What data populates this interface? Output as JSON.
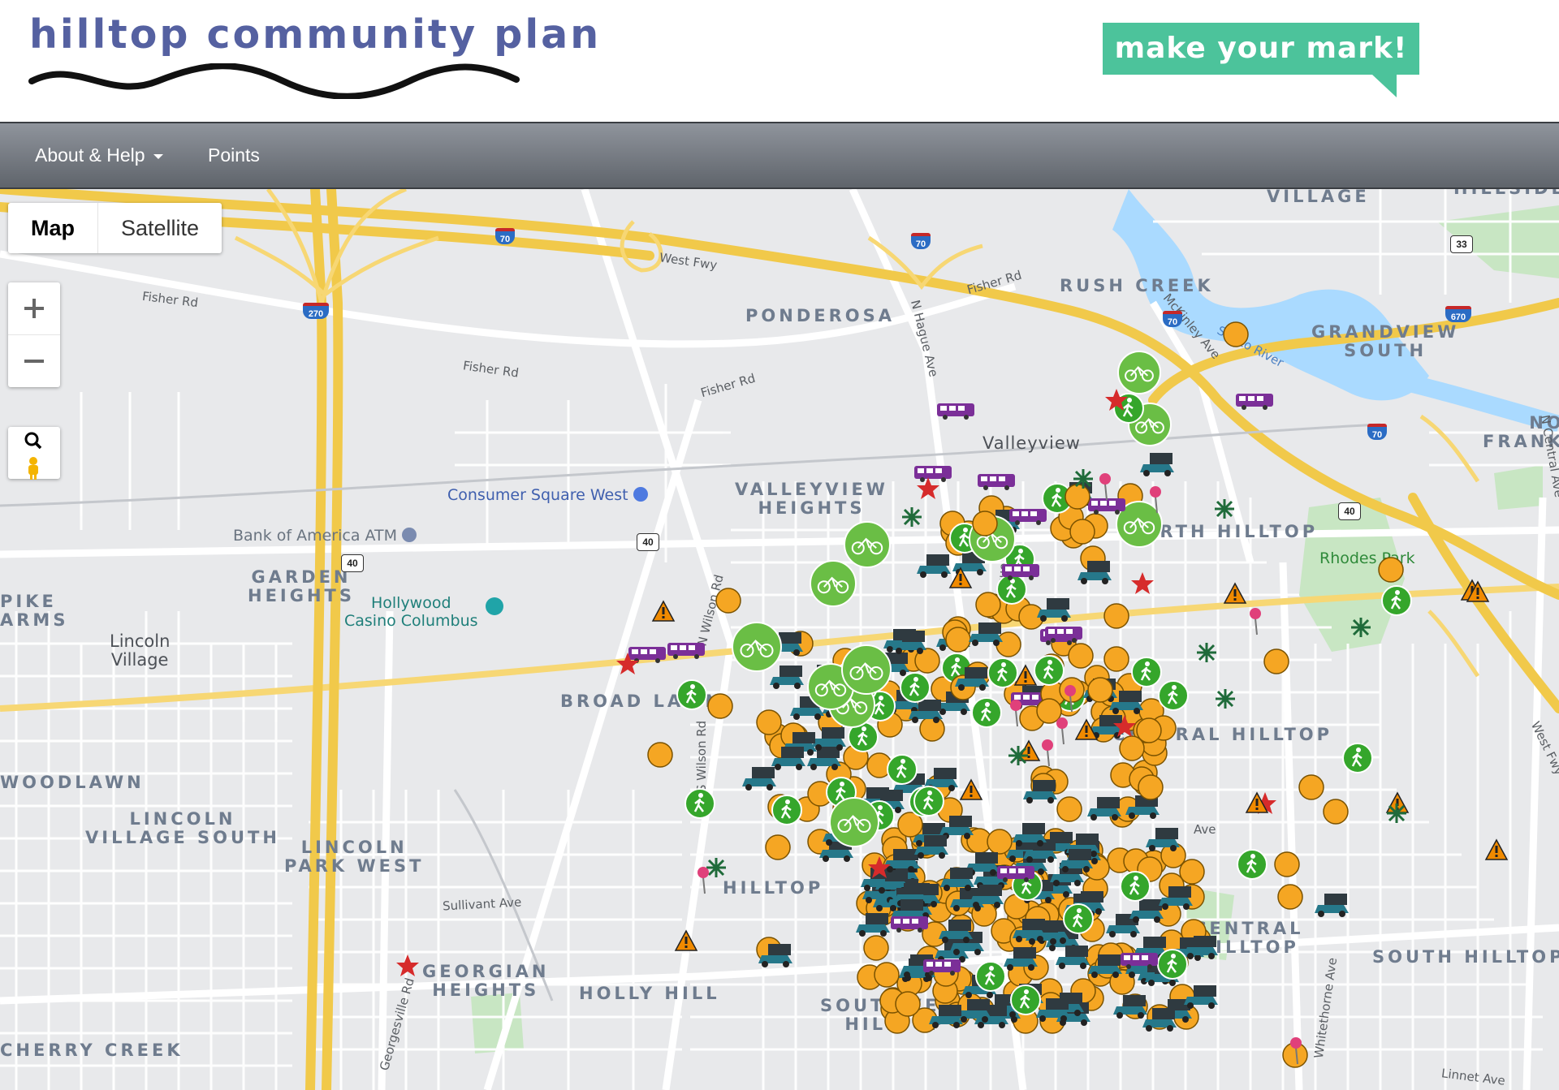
{
  "header": {
    "site_title": "hilltop community plan",
    "cta_label": "make your mark!"
  },
  "navbar": {
    "about_label": "About & Help",
    "points_label": "Points"
  },
  "map_controls": {
    "map_label": "Map",
    "satellite_label": "Satellite",
    "zoom_in_icon": "plus-icon",
    "zoom_out_icon": "minus-icon",
    "search_icon": "search-icon",
    "pegman_icon": "pegman-icon"
  },
  "map_labels": {
    "neighborhoods": [
      "VILLAGE",
      "HILLSIDE",
      "RUSH CREEK",
      "PONDEROSA",
      "GRANDVIEW\nSOUTH",
      "NO\nFRANK",
      "VALLEYVIEW\nHEIGHTS",
      "NORTH HILLTOP",
      "GARDEN\nHEIGHTS",
      "PIKE\nARMS",
      "BROAD LAWN",
      "CENTRAL HILLTOP",
      "WOODLAWN",
      "LINCOLN\nVILLAGE SOUTH",
      "LINCOLN\nPARK WEST",
      "HILLTOP",
      "CENTRAL\nHILLTOP",
      "SOUTH HILLTOP",
      "GEORGIAN\nHEIGHTS",
      "HOLLY HILL",
      "SOUTHWEST\nHILLTOP",
      "CHERRY CREEK"
    ],
    "places": [
      "Valleyview",
      "Lincoln\nVillage"
    ],
    "roads": [
      "West Fwy",
      "Fisher Rd",
      "Fisher Rd",
      "Fisher Rd",
      "Fisher Rd",
      "N Hague Ave",
      "McKinley Ave",
      "Scioto River",
      "N Wilson Rd",
      "S Wilson Rd",
      "Sullivant Ave",
      "Georgesville Rd",
      "N Central Ave",
      "West Fwy",
      "Whitethorne Ave",
      "Linnet Ave",
      "Hague Ave",
      "Ave"
    ],
    "pois": [
      {
        "name": "Consumer Square West",
        "color": "#3f5fae"
      },
      {
        "name": "Bank of America ATM",
        "color": "#6a7480"
      },
      {
        "name": "Hollywood\nCasino Columbus",
        "color": "#1f7f7a"
      },
      {
        "name": "Rhodes Park",
        "color": "#2f8a3a"
      }
    ],
    "highway_shields": [
      "70",
      "70",
      "270",
      "40",
      "40",
      "70",
      "70",
      "670",
      "33",
      "40"
    ]
  },
  "marker_types": {
    "comment": "orange-circle-icon",
    "bike": "bicycle-icon",
    "walk": "pedestrian-icon",
    "car": "car-icon",
    "bus": "bus-icon",
    "star": "star-icon",
    "warning": "warning-icon",
    "tree": "tree-icon",
    "pin": "pin-icon"
  },
  "colors": {
    "title": "#5561a1",
    "cta": "#4cc39b",
    "comment": "#f5a623",
    "bike": "#6abe45",
    "walk": "#35a62b",
    "car": "#26788a",
    "bus": "#7b2f98",
    "star": "#d62b2b",
    "warning": "#f08a00",
    "tree": "#1f6b3a",
    "pin": "#e0407a",
    "freeway": "#f7d774"
  }
}
